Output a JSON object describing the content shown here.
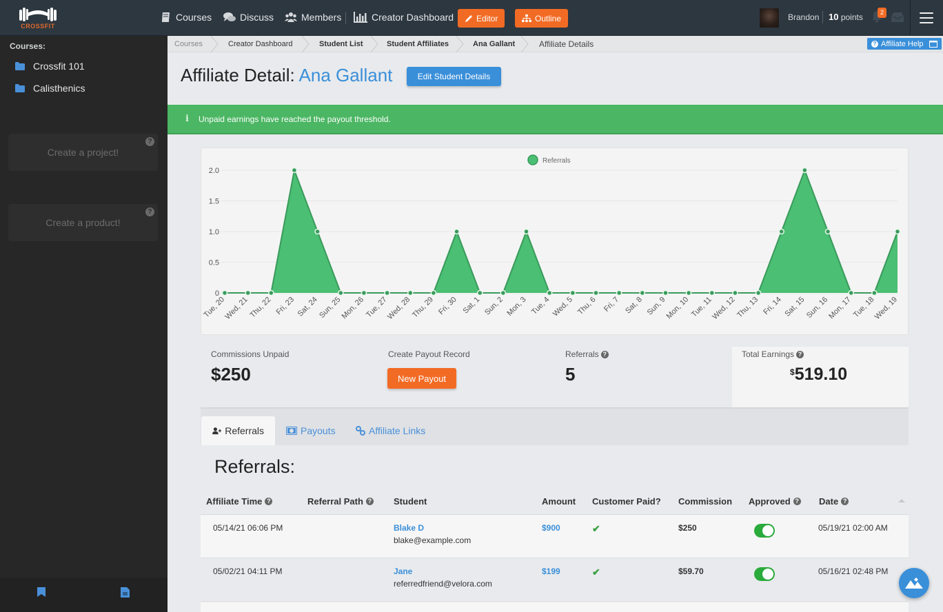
{
  "topnav": {
    "brand": "CROSSFIT",
    "items": [
      {
        "label": "Courses",
        "icon": "book-icon"
      },
      {
        "label": "Discuss",
        "icon": "comments-icon"
      },
      {
        "label": "Members",
        "icon": "users-icon"
      },
      {
        "label": "Creator Dashboard",
        "icon": "bar-chart-icon"
      }
    ],
    "editor_label": "Editor",
    "outline_label": "Outline",
    "user_name": "Brandon",
    "points_value": "10",
    "points_label": "points",
    "notification_count": "2"
  },
  "sidebar": {
    "title": "Courses:",
    "courses": [
      {
        "label": "Crossfit 101"
      },
      {
        "label": "Calisthenics"
      }
    ],
    "create_project": "Create a project!",
    "create_product": "Create a product!",
    "help_glyph": "?"
  },
  "breadcrumb": [
    {
      "label": "Courses"
    },
    {
      "label": "Creator Dashboard"
    },
    {
      "label": "Student List"
    },
    {
      "label": "Student Affiliates"
    },
    {
      "label": "Ana Gallant"
    },
    {
      "label": "Affiliate Details"
    }
  ],
  "help_button": "Affiliate Help",
  "page": {
    "title_prefix": "Affiliate Detail:",
    "title_name": "Ana Gallant",
    "edit_button": "Edit Student Details",
    "alert": "Unpaid earnings have reached the payout threshold."
  },
  "chart_data": {
    "type": "area",
    "title": "",
    "legend": [
      "Referrals"
    ],
    "legend_position": "top-center",
    "xlabel": "",
    "ylabel": "",
    "ylim": [
      0,
      2
    ],
    "yticks": [
      "0",
      "0.5",
      "1.0",
      "1.5",
      "2.0"
    ],
    "ytick_values": [
      0,
      0.5,
      1,
      1.5,
      2
    ],
    "color": "#4bbf73",
    "line_color": "#3a9a5c",
    "categories": [
      "Tue, 20",
      "Wed, 21",
      "Thu, 22",
      "Fri, 23",
      "Sat, 24",
      "Sun, 25",
      "Mon, 26",
      "Tue, 27",
      "Wed, 28",
      "Thu, 29",
      "Fri, 30",
      "Sat, 1",
      "Sun, 2",
      "Mon, 3",
      "Tue, 4",
      "Wed, 5",
      "Thu, 6",
      "Fri, 7",
      "Sat, 8",
      "Sun, 9",
      "Mon, 10",
      "Tue, 11",
      "Wed, 12",
      "Thu, 13",
      "Fri, 14",
      "Sat, 15",
      "Sun, 16",
      "Mon, 17",
      "Tue, 18",
      "Wed, 19"
    ],
    "series": [
      {
        "name": "Referrals",
        "values": [
          0,
          0,
          0,
          2,
          1,
          0,
          0,
          0,
          0,
          0,
          1,
          0,
          0,
          1,
          0,
          0,
          0,
          0,
          0,
          0,
          0,
          0,
          0,
          0,
          1,
          2,
          1,
          0,
          0,
          1
        ]
      }
    ]
  },
  "stats": {
    "commissions_unpaid_label": "Commissions Unpaid",
    "commissions_unpaid_value": "$250",
    "payout_record_label": "Create Payout Record",
    "new_payout_button": "New Payout",
    "referrals_label": "Referrals",
    "referrals_value": "5",
    "total_earnings_label": "Total Earnings",
    "total_earnings_currency": "$",
    "total_earnings_value": "519.10"
  },
  "tabs": [
    {
      "label": "Referrals",
      "active": true
    },
    {
      "label": "Payouts",
      "active": false
    },
    {
      "label": "Affiliate Links",
      "active": false
    }
  ],
  "referrals_section": {
    "title": "Referrals:",
    "columns": [
      "Affiliate Time",
      "Referral Path",
      "Student",
      "Amount",
      "Customer Paid?",
      "Commission",
      "Approved",
      "Date"
    ],
    "rows": [
      {
        "affiliate_time": "05/14/21 06:06 PM",
        "referral_path": "",
        "student_name": "Blake D",
        "student_email": "blake@example.com",
        "amount": "$900",
        "customer_paid": true,
        "commission": "$250",
        "approved": true,
        "date": "05/19/21 02:00 AM"
      },
      {
        "affiliate_time": "05/02/21 04:11 PM",
        "referral_path": "",
        "student_name": "Jane",
        "student_email": "referredfriend@velora.com",
        "amount": "$199",
        "customer_paid": true,
        "commission": "$59.70",
        "approved": true,
        "date": "05/16/21 02:48 PM"
      }
    ],
    "check_glyph": "✔"
  }
}
